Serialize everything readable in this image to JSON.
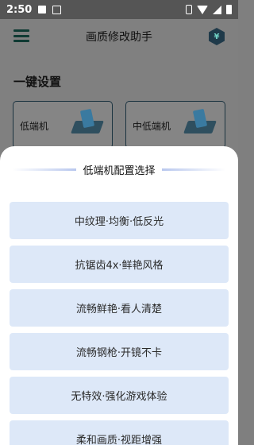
{
  "status_bar": {
    "time": "2:50",
    "icons": [
      "image-icon",
      "text-notification-icon",
      "vibrate-icon",
      "wifi-icon",
      "cell-signal-icon",
      "battery-icon"
    ]
  },
  "app": {
    "title": "画质修改助手",
    "section_title": "一键设置",
    "cards": [
      {
        "label": "低端机"
      },
      {
        "label": "中低端机"
      }
    ]
  },
  "sheet": {
    "title": "低端机配置选择",
    "options": [
      "中纹理·均衡·低反光",
      "抗锯齿4x·鲜艳风格",
      "流畅鲜艳·看人清楚",
      "流畅钢枪·开镜不卡",
      "无特效·强化游戏体验",
      "柔和画质·视距增强"
    ]
  },
  "colors": {
    "option_bg": "#dde8f8",
    "sheet_bg": "#ffffff",
    "overlay": "#808080",
    "accent_deco": "#b9c8ee"
  }
}
